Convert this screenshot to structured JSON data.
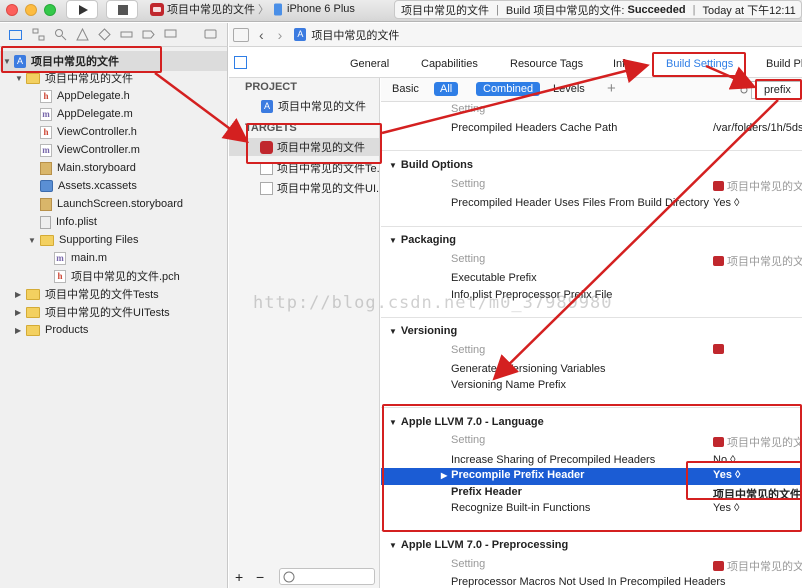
{
  "toolbar": {
    "scheme_target": "项目中常见的文件",
    "scheme_sep": "〉",
    "device": "iPhone 6 Plus",
    "status_project": "项目中常见的文件",
    "status_sep": "|",
    "status_build": "Build 项目中常见的文件:",
    "status_result": "Succeeded",
    "status_sep2": "|",
    "status_time": "Today at 下午12:11"
  },
  "navigator": {
    "items": [
      {
        "label": "项目中常见的文件",
        "icon": "project-icon"
      },
      {
        "label": "项目中常见的文件",
        "icon": "folder-icon"
      },
      {
        "label": "AppDelegate.h",
        "icon": "header-file-icon",
        "glyph": "h"
      },
      {
        "label": "AppDelegate.m",
        "icon": "source-file-icon",
        "glyph": "m"
      },
      {
        "label": "ViewController.h",
        "icon": "header-file-icon",
        "glyph": "h"
      },
      {
        "label": "ViewController.m",
        "icon": "source-file-icon",
        "glyph": "m"
      },
      {
        "label": "Main.storyboard",
        "icon": "storyboard-icon"
      },
      {
        "label": "Assets.xcassets",
        "icon": "asset-catalog-icon"
      },
      {
        "label": "LaunchScreen.storyboard",
        "icon": "storyboard-icon"
      },
      {
        "label": "Info.plist",
        "icon": "plist-icon"
      },
      {
        "label": "Supporting Files",
        "icon": "folder-icon"
      },
      {
        "label": "main.m",
        "icon": "source-file-icon",
        "glyph": "m"
      },
      {
        "label": "项目中常见的文件.pch",
        "icon": "header-file-icon",
        "glyph": "h"
      },
      {
        "label": "项目中常见的文件Tests",
        "icon": "folder-icon"
      },
      {
        "label": "项目中常见的文件UITests",
        "icon": "folder-icon"
      },
      {
        "label": "Products",
        "icon": "folder-icon"
      }
    ],
    "add_label": "+",
    "remove_label": "−"
  },
  "jumpbar": {
    "back": "‹",
    "forward": "›",
    "project": "项目中常见的文件"
  },
  "editor_tabs": [
    "General",
    "Capabilities",
    "Resource Tags",
    "Info",
    "Build Settings",
    "Build Pha"
  ],
  "target_list": {
    "project_header": "PROJECT",
    "project_item": "项目中常见的文件",
    "targets_header": "TARGETS",
    "targets": [
      "项目中常见的文件",
      "项目中常见的文件Te...",
      "项目中常见的文件UI..."
    ]
  },
  "filter": {
    "basic": "Basic",
    "all": "All",
    "combined": "Combined",
    "levels": "Levels",
    "add": "+",
    "search_value": "prefix"
  },
  "settings": {
    "top_rows": [
      {
        "name": "Setting",
        "value": ""
      },
      {
        "name": "Precompiled Headers Cache Path",
        "value": "/var/folders/1h/5ds"
      }
    ],
    "sections": [
      {
        "title": "Build Options",
        "rows": [
          {
            "name": "Setting",
            "value": "项目中常见的文件"
          },
          {
            "name": "Precompiled Header Uses Files From Build Directory",
            "value": "Yes ◊"
          }
        ]
      },
      {
        "title": "Packaging",
        "rows": [
          {
            "name": "Setting",
            "value": "项目中常见的文件"
          },
          {
            "name": "Executable Prefix",
            "value": ""
          },
          {
            "name": "Info.plist Preprocessor Prefix File",
            "value": ""
          }
        ]
      },
      {
        "title": "Versioning",
        "rows": [
          {
            "name": "Setting",
            "value": ""
          },
          {
            "name": "Generated Versioning Variables",
            "value": ""
          },
          {
            "name": "Versioning Name Prefix",
            "value": ""
          }
        ]
      },
      {
        "title": "Apple LLVM 7.0 - Language",
        "rows": [
          {
            "name": "Setting",
            "value": "项目中常见的文件"
          },
          {
            "name": "Increase Sharing of Precompiled Headers",
            "value": "No ◊"
          },
          {
            "name": "Precompile Prefix Header",
            "value": "Yes ◊"
          },
          {
            "name": "Prefix Header",
            "value": "项目中常见的文件/项"
          },
          {
            "name": "Recognize Built-in Functions",
            "value": "Yes ◊"
          }
        ]
      },
      {
        "title": "Apple LLVM 7.0 - Preprocessing",
        "rows": [
          {
            "name": "Setting",
            "value": "项目中常见的文件"
          },
          {
            "name": "Preprocessor Macros Not Used In Precompiled Headers",
            "value": ""
          }
        ]
      }
    ]
  },
  "watermark": "http://blog.csdn.net/m0_37989980",
  "colors": {
    "selection": "#1b5cd4",
    "annotation": "#d42020",
    "accent": "#2f7ee6"
  }
}
